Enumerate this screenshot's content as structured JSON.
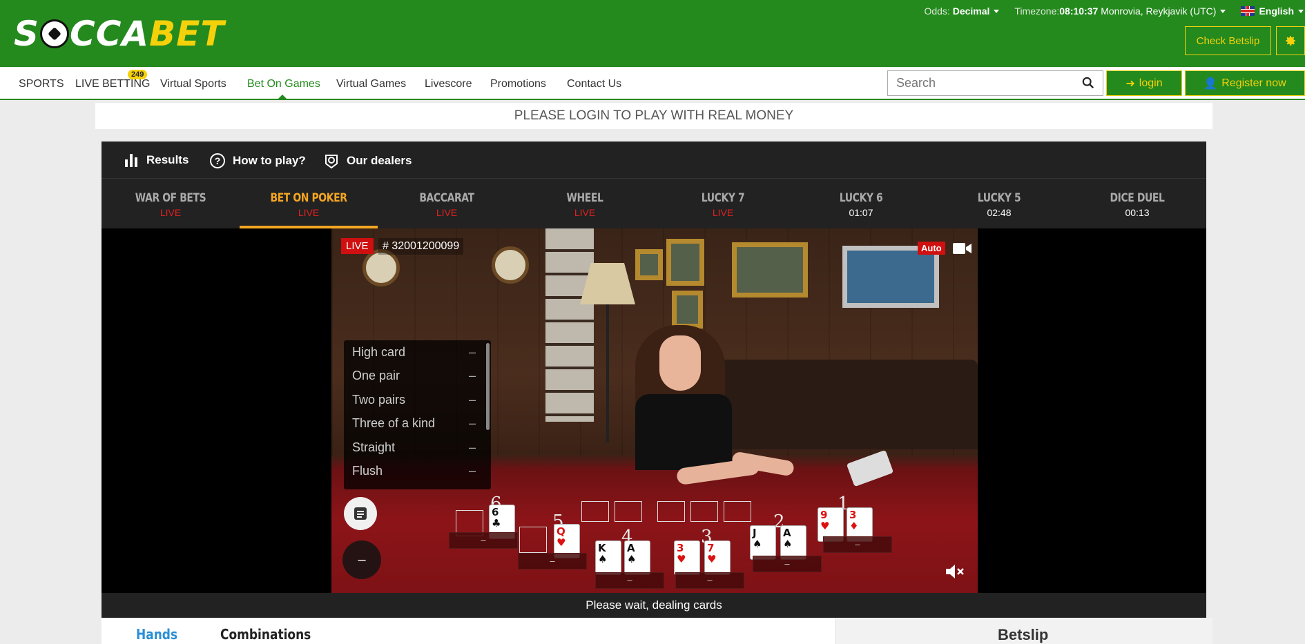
{
  "header": {
    "logo_left": "SO",
    "logo_mid": "CCA",
    "logo_right": "BET",
    "odds_label": "Odds:",
    "odds_value": "Decimal",
    "timezone_label": "Timezone:",
    "time": "08:10:37",
    "timezone_value": "Monrovia, Reykjavik (UTC)",
    "language": "English",
    "check_betslip": "Check Betslip"
  },
  "nav": {
    "items": [
      "SPORTS",
      "LIVE BETTING",
      "Virtual Sports",
      "Bet On Games",
      "Virtual Games",
      "Livescore",
      "Promotions",
      "Contact Us"
    ],
    "live_count": "249",
    "search_placeholder": "Search",
    "login": "login",
    "register": "Register now"
  },
  "banner": "PLEASE LOGIN TO PLAY WITH REAL MONEY",
  "game": {
    "tools": [
      "Results",
      "How to play?",
      "Our dealers"
    ],
    "tabs": [
      {
        "name": "WAR OF BETS",
        "status": "LIVE"
      },
      {
        "name": "BET ON POKER",
        "status": "LIVE"
      },
      {
        "name": "BACCARAT",
        "status": "LIVE"
      },
      {
        "name": "WHEEL",
        "status": "LIVE"
      },
      {
        "name": "LUCKY 7",
        "status": "LIVE"
      },
      {
        "name": "LUCKY 6",
        "status": "01:07"
      },
      {
        "name": "LUCKY 5",
        "status": "02:48"
      },
      {
        "name": "DICE DUEL",
        "status": "00:13"
      }
    ],
    "live_label": "LIVE",
    "round_id": "# 32001200099",
    "auto_label": "Auto",
    "hands": [
      {
        "name": "High card",
        "value": "–"
      },
      {
        "name": "One pair",
        "value": "–"
      },
      {
        "name": "Two pairs",
        "value": "–"
      },
      {
        "name": "Three of a kind",
        "value": "–"
      },
      {
        "name": "Straight",
        "value": "–"
      },
      {
        "name": "Flush",
        "value": "–"
      }
    ],
    "dash_value": "–",
    "seat_numbers": [
      "6",
      "5",
      "4",
      "3",
      "2",
      "1"
    ],
    "seat_odds": [
      "–",
      "–",
      "–",
      "–",
      "–",
      "–"
    ],
    "status": "Please wait, dealing cards"
  },
  "bottom": {
    "tab_hands": "Hands",
    "tab_combinations": "Combinations",
    "betslip": "Betslip"
  }
}
